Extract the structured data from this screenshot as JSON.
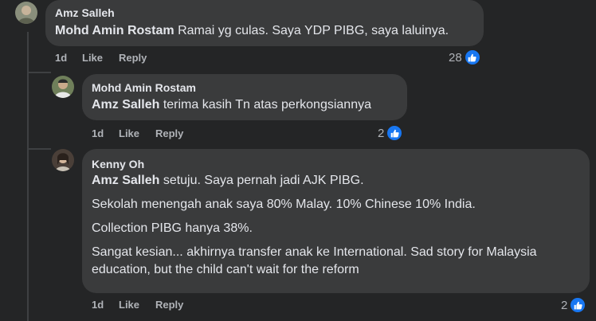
{
  "comments": [
    {
      "author": "Amz Salleh",
      "mention": "Mohd Amin Rostam",
      "text": "Ramai yg culas. Saya YDP PIBG, saya laluinya.",
      "time": "1d",
      "like_label": "Like",
      "reply_label": "Reply",
      "reaction_count": "28"
    },
    {
      "author": "Mohd Amin Rostam",
      "mention": "Amz Salleh",
      "text": "terima kasih Tn atas perkongsiannya",
      "time": "1d",
      "like_label": "Like",
      "reply_label": "Reply",
      "reaction_count": "2"
    },
    {
      "author": "Kenny Oh",
      "mention": "Amz Salleh",
      "text": "setuju. Saya pernah jadi AJK PIBG.",
      "paragraphs": [
        "Sekolah menengah anak saya 80% Malay. 10% Chinese 10% India.",
        "Collection PIBG hanya 38%.",
        "Sangat kesian... akhirnya transfer anak ke International. Sad story for Malaysia education, but the child can't wait for the reform"
      ],
      "time": "1d",
      "like_label": "Like",
      "reply_label": "Reply",
      "reaction_count": "2"
    }
  ],
  "colors": {
    "background": "#242526",
    "bubble": "#3a3b3c",
    "like_blue": "#1877f2",
    "meta": "#b0b3b8"
  }
}
